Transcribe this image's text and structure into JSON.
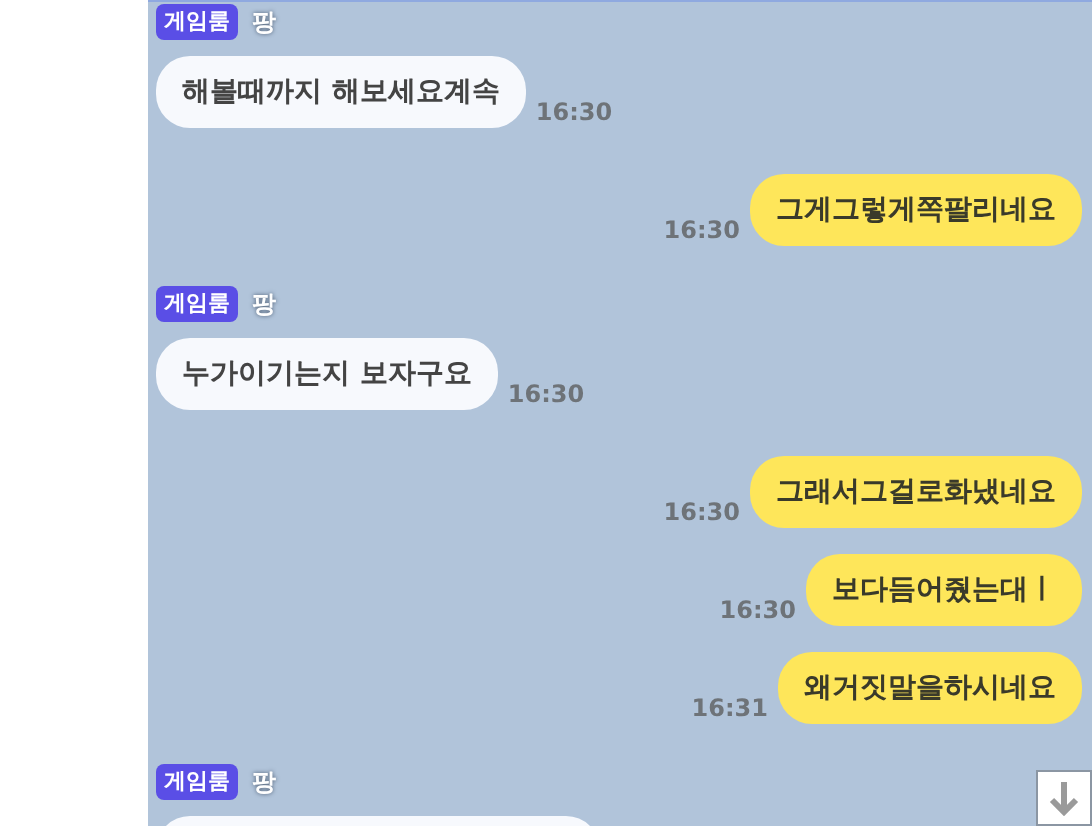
{
  "messages": [
    {
      "kind": "received",
      "badge": "게임룸",
      "sender": "팡",
      "text": "해볼때까지 해보세요계속",
      "time": "16:30"
    },
    {
      "kind": "sent",
      "text": "그게그렇게쪽팔리네요",
      "time": "16:30"
    },
    {
      "kind": "received",
      "badge": "게임룸",
      "sender": "팡",
      "text": "누가이기는지 보자구요",
      "time": "16:30"
    },
    {
      "kind": "sent",
      "text": "그래서그걸로화냈네요",
      "time": "16:30"
    },
    {
      "kind": "sent",
      "text": "보다듬어줬는대ㅣ",
      "time": "16:30"
    },
    {
      "kind": "sent",
      "text": "왜거짓말을하시네요",
      "time": "16:31"
    },
    {
      "kind": "received",
      "badge": "게임룸",
      "sender": "팡"
    }
  ]
}
